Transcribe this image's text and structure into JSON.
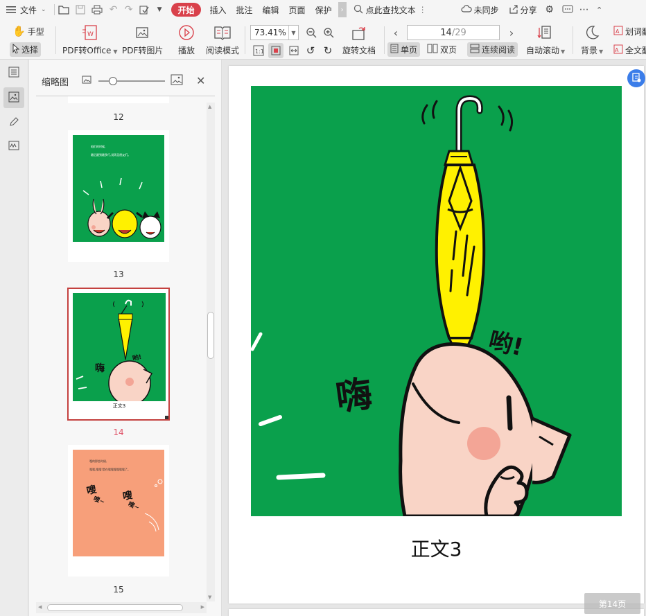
{
  "menu": {
    "file": "文件",
    "start": "开始",
    "insert": "插入",
    "annotate": "批注",
    "edit": "编辑",
    "page": "页面",
    "protect": "保护",
    "search": "点此查找文本",
    "sync": "未同步",
    "share": "分享"
  },
  "toolbar": {
    "hand": "手型",
    "select": "选择",
    "pdf_to_office": "PDF转Office",
    "pdf_to_image": "PDF转图片",
    "play": "播放",
    "read_mode": "阅读模式",
    "zoom": "73.41%",
    "rotate_doc": "旋转文档",
    "page_current": "14",
    "page_total": "/29",
    "single_page": "单页",
    "double_page": "双页",
    "continuous": "连续阅读",
    "auto_scroll": "自动滚动",
    "background": "背景",
    "word_translate": "划词翻",
    "full_translate": "全文翻"
  },
  "panel": {
    "title": "缩略图",
    "thumbs": [
      {
        "num": "12"
      },
      {
        "num": "13",
        "lines": [
          "咱们的时候,",
          "最后跟到最多行,说再见朋友们。"
        ]
      },
      {
        "num": "14",
        "caption": "正文3",
        "hi": "嗨",
        "yo": "哟!"
      },
      {
        "num": "15",
        "lines": [
          "嗖的那些时候,",
          "嗖嗖,嗖嗖!是在嗖嗖嗖嗖嗖嗖了。"
        ],
        "sou1": "嗖",
        "sou1b": "嗖~",
        "sou2": "嗖",
        "sou2b": "嗖~"
      }
    ]
  },
  "document": {
    "hi": "嗨",
    "yo": "哟!",
    "caption": "正文3",
    "page_badge": "第14页"
  },
  "colors": {
    "green": "#0aa04c",
    "pig": "#f9d4c6",
    "cheek": "#f3a596",
    "umbrella": "#fff100",
    "orange": "#f79f7a",
    "accent": "#d9414b"
  }
}
